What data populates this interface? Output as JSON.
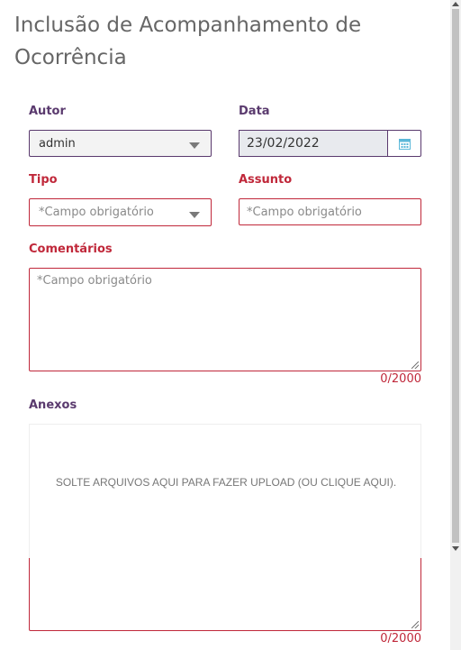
{
  "page": {
    "title": "Inclusão de Acompanhamento de Ocorrência"
  },
  "form": {
    "autor": {
      "label": "Autor",
      "value": "admin"
    },
    "data": {
      "label": "Data",
      "value": "23/02/2022",
      "icon": "calendar-icon"
    },
    "tipo": {
      "label": "Tipo",
      "placeholder": "*Campo obrigatório"
    },
    "assunto": {
      "label": "Assunto",
      "placeholder": "*Campo obrigatório"
    },
    "comentarios": {
      "label": "Comentários",
      "placeholder": "*Campo obrigatório",
      "counter": "0/2000"
    },
    "anexos": {
      "label": "Anexos",
      "dropzone_text": "SOLTE ARQUIVOS AQUI PARA FAZER UPLOAD (OU CLIQUE AQUI).",
      "counter": "0/2000"
    }
  },
  "colors": {
    "label": "#5a3a6e",
    "required": "#c0283a",
    "calendar_icon": "#5bb8d9"
  }
}
